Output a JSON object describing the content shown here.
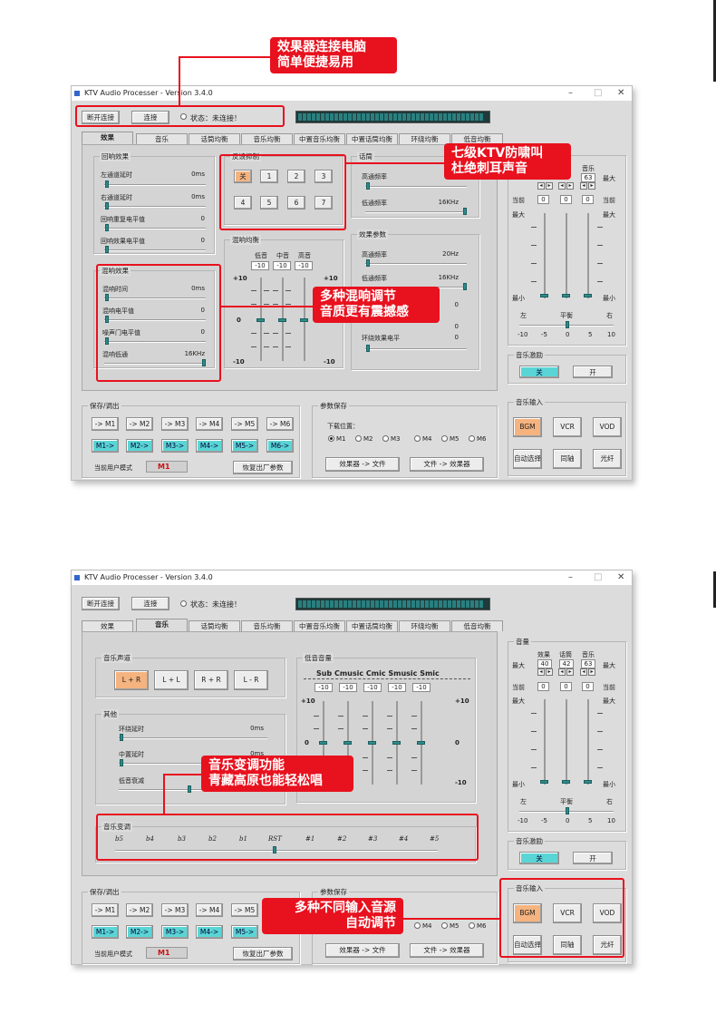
{
  "window": {
    "title": "KTV Audio Processer - Version 3.4.0",
    "min": "–",
    "max": "□",
    "close": "✕"
  },
  "top": {
    "disconnect": "断开连接",
    "connect": "连接",
    "status": "状态：未连接！"
  },
  "tabs": [
    "效果",
    "音乐",
    "话筒均衡",
    "音乐均衡",
    "中置音乐均衡",
    "中置话筒均衡",
    "环绕均衡",
    "低音均衡"
  ],
  "callouts": {
    "c1_line1": "效果器连接电脑",
    "c1_line2": "简单便捷易用",
    "c2_line1": "七级KTV防啸叫",
    "c2_line2": "杜绝刺耳声音",
    "c3_line1": "多种混响调节",
    "c3_line2": "音质更有震撼感",
    "c4_line1": "音乐变调功能",
    "c4_line2": "青藏高原也能轻松唱",
    "c5_line1": "多种不同输入音源",
    "c5_line2": "自动调节"
  },
  "effect": {
    "echo_title": "回响效果",
    "echo": [
      {
        "label": "左通道延时",
        "value": "0ms"
      },
      {
        "label": "右通道延时",
        "value": "0ms"
      },
      {
        "label": "回响重复电平值",
        "value": "0"
      },
      {
        "label": "回响效果电平值",
        "value": "0"
      }
    ],
    "reverb_title": "混响效果",
    "reverb": [
      {
        "label": "混响时间",
        "value": "0ms"
      },
      {
        "label": "混响电平值",
        "value": "0"
      },
      {
        "label": "噪声门电平值",
        "value": "0"
      },
      {
        "label": "混响低通",
        "value": "16KHz"
      }
    ],
    "fb_title": "反馈抑制",
    "fb_buttons": [
      "关",
      "1",
      "2",
      "3",
      "4",
      "5",
      "6",
      "7"
    ],
    "reverb_eq_title": "混响均衡",
    "reverb_eq_cols": [
      "低音",
      "中音",
      "高音"
    ],
    "reverb_eq_vals": [
      "-10",
      "-10",
      "-10"
    ],
    "scale_top": "+10",
    "scale_mid": "0",
    "scale_bot": "-10",
    "voice_title": "话筒",
    "voice": [
      {
        "label": "高通频率",
        "value": ""
      },
      {
        "label": "低通频率",
        "value": "16KHz"
      }
    ],
    "fx_title": "效果参数",
    "fx": [
      {
        "label": "高通频率",
        "value": "20Hz"
      },
      {
        "label": "低通频率",
        "value": "16KHz"
      },
      {
        "label": "",
        "value": "0"
      },
      {
        "label": "",
        "value": "0"
      },
      {
        "label": "环绕效果电平",
        "value": "0"
      }
    ]
  },
  "volume": {
    "title": "音量",
    "cols": [
      "效果",
      "话筒",
      "音乐"
    ],
    "vals": [
      "40",
      "42",
      "63"
    ],
    "max": "最大",
    "cur": "当前",
    "min": "最小",
    "cur_vals": [
      "0",
      "0",
      "0"
    ],
    "balance": "平衡",
    "left": "左",
    "right": "右",
    "bal_ticks": [
      "-10",
      "-5",
      "0",
      "5",
      "10"
    ]
  },
  "exciter": {
    "title": "音乐激励",
    "off": "关",
    "on": "开"
  },
  "input": {
    "title": "音乐输入",
    "buttons": [
      "BGM",
      "VCR",
      "VOD",
      "自动选择",
      "同轴",
      "光纤"
    ]
  },
  "save": {
    "title": "保存/调出",
    "save_btns": [
      "-> M1",
      "-> M2",
      "-> M3",
      "-> M4",
      "-> M5",
      "-> M6"
    ],
    "load_btns": [
      "M1->",
      "M2->",
      "M3->",
      "M4->",
      "M5->",
      "M6->"
    ],
    "current_label": "当前用户模式",
    "current_val": "M1",
    "reset": "恢复出厂参数"
  },
  "params": {
    "title": "参数保存",
    "slot_label": "下载位置：",
    "slots": [
      "M1",
      "M2",
      "M3",
      "M4",
      "M5",
      "M6"
    ],
    "to_file": "效果器 -> 文件",
    "to_device": "文件 -> 效果器"
  },
  "music": {
    "channel_title": "音乐声道",
    "channel_btns": [
      "L + R",
      "L + L",
      "R + R",
      "L - R"
    ],
    "other_title": "其他",
    "other": [
      {
        "label": "环绕延时",
        "value": "0ms"
      },
      {
        "label": "中置延时",
        "value": "0ms"
      },
      {
        "label": "低音衰减",
        "value": ""
      }
    ],
    "bass_title": "低音音量",
    "bass_cols": "Sub Cmusic Cmic Smusic Smic",
    "bass_vals": [
      "-10",
      "-10",
      "-10",
      "-10",
      "-10"
    ],
    "key_title": "音乐变调",
    "key_ticks": [
      "b5",
      "b4",
      "b3",
      "b2",
      "b1",
      "RST",
      "#1",
      "#2",
      "#3",
      "#4",
      "#5"
    ]
  }
}
